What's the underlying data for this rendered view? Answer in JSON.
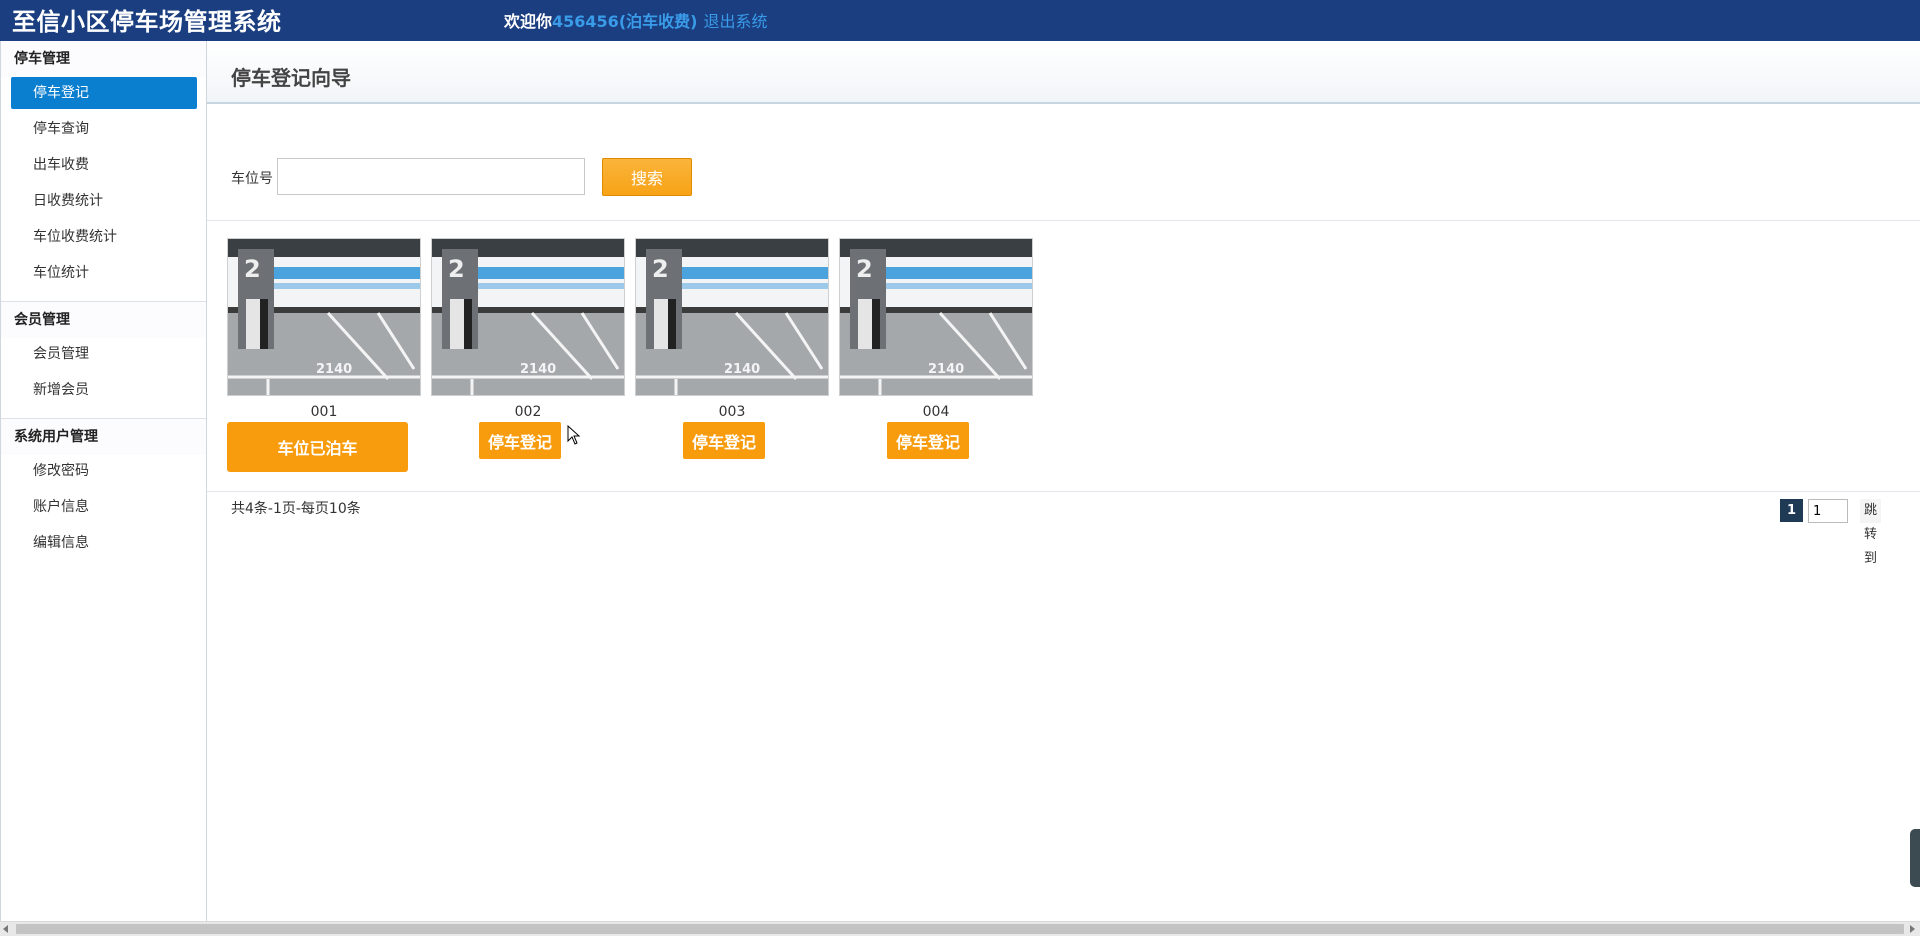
{
  "header": {
    "system_title": "至信小区停车场管理系统",
    "welcome_prefix": "欢迎你",
    "user_label": "456456(泊车收费)",
    "logout_label": "退出系统"
  },
  "sidebar": {
    "groups": [
      {
        "title": "停车管理",
        "items": [
          {
            "label": "停车登记",
            "active": true
          },
          {
            "label": "停车查询"
          },
          {
            "label": "出车收费"
          },
          {
            "label": "日收费统计"
          },
          {
            "label": "车位收费统计"
          },
          {
            "label": "车位统计"
          }
        ]
      },
      {
        "title": "会员管理",
        "items": [
          {
            "label": "会员管理"
          },
          {
            "label": "新增会员"
          }
        ]
      },
      {
        "title": "系统用户管理",
        "items": [
          {
            "label": "修改密码"
          },
          {
            "label": "账户信息"
          },
          {
            "label": "编辑信息"
          }
        ]
      }
    ]
  },
  "main": {
    "page_title": "停车登记向导",
    "search": {
      "label": "车位号",
      "value": "",
      "button_label": "搜索"
    },
    "spots": [
      {
        "code": "001",
        "button_label": "车位已泊车",
        "occupied": true,
        "pillar_number": "2",
        "floor_number": "2140"
      },
      {
        "code": "002",
        "button_label": "停车登记",
        "occupied": false,
        "pillar_number": "2",
        "floor_number": "2140"
      },
      {
        "code": "003",
        "button_label": "停车登记",
        "occupied": false,
        "pillar_number": "2",
        "floor_number": "2140"
      },
      {
        "code": "004",
        "button_label": "停车登记",
        "occupied": false,
        "pillar_number": "2",
        "floor_number": "2140"
      }
    ],
    "pager": {
      "summary": "共4条-1页-每页10条",
      "current_page": "1",
      "page_input_value": "1",
      "jump_label": "跳转到"
    }
  },
  "colors": {
    "header_bg": "#1a3e80",
    "accent_blue": "#0b7fcf",
    "button_orange": "#f89c0d"
  }
}
